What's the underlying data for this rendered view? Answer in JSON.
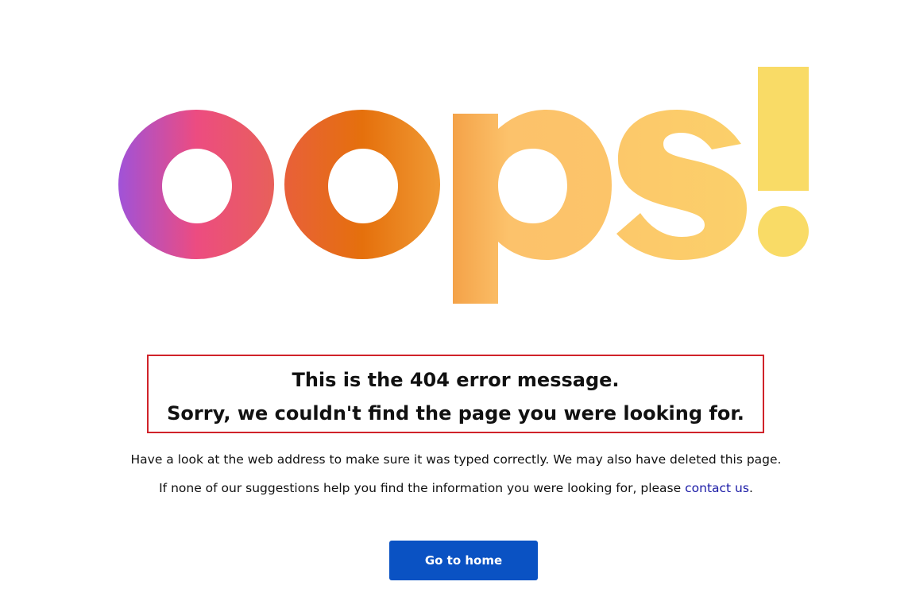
{
  "hero": {
    "headline": "oops!",
    "colors": {
      "purple": "#a052d8",
      "pink": "#ec4c81",
      "orange": "#e5700c",
      "amber": "#f4a248",
      "light_orange": "#fcc26b",
      "yellow": "#f9db66"
    }
  },
  "message": {
    "line1": "This is the 404 error message.",
    "line2": "Sorry, we couldn't find the page you were looking for.",
    "border_color": "#d0232a"
  },
  "body": {
    "paragraph1": "Have a look at the web address to make sure it was typed correctly. We may also have deleted this page.",
    "paragraph2_prefix": "If none of our suggestions help you find the information you were looking for, please ",
    "contact_link": "contact us",
    "paragraph2_suffix": "."
  },
  "actions": {
    "home_button": "Go to home",
    "button_color": "#0a52c3"
  }
}
